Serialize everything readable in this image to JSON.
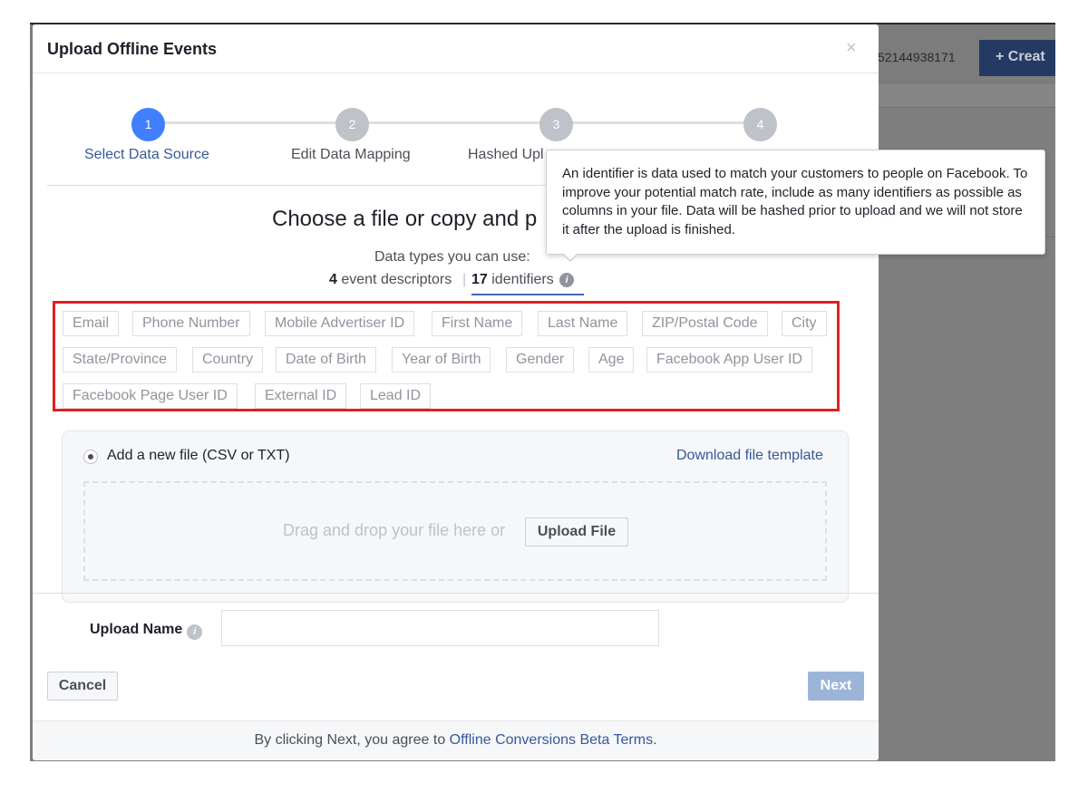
{
  "background": {
    "account_id": "52144938171",
    "create_label": "+ Creat"
  },
  "modal": {
    "title": "Upload Offline Events",
    "close_symbol": "×"
  },
  "steps": [
    {
      "number": "1",
      "label": "Select Data Source"
    },
    {
      "number": "2",
      "label": "Edit Data Mapping"
    },
    {
      "number": "3",
      "label": "Hashed Upl"
    },
    {
      "number": "4",
      "label": ""
    }
  ],
  "main": {
    "heading": "Choose a file or copy and p",
    "data_types_label": "Data types you can use:",
    "tabs": {
      "events_count": "4",
      "events_text": "event descriptors",
      "separator": "|",
      "identifiers_count": "17",
      "identifiers_text": "identifiers"
    },
    "identifiers": [
      "Email",
      "Phone Number",
      "Mobile Advertiser ID",
      "First Name",
      "Last Name",
      "ZIP/Postal Code",
      "City",
      "State/Province",
      "Country",
      "Date of Birth",
      "Year of Birth",
      "Gender",
      "Age",
      "Facebook App User ID",
      "Facebook Page User ID",
      "External ID",
      "Lead ID"
    ]
  },
  "file_panel": {
    "radio_label": "Add a new file (CSV or TXT)",
    "download_link": "Download file template",
    "drop_text": "Drag and drop your file here or",
    "upload_button": "Upload File"
  },
  "form": {
    "upload_name_label": "Upload Name",
    "upload_name_value": "",
    "cancel_label": "Cancel",
    "next_label": "Next"
  },
  "footer": {
    "prefix": "By clicking Next, you agree to ",
    "terms_link": "Offline Conversions Beta Terms",
    "suffix": "."
  },
  "tooltip": {
    "text": "An identifier is data used to match your customers to people on Facebook. To improve your potential match rate, include as many identifiers as possible as columns in your file. Data will be hashed prior to upload and we will not store it after the upload is finished."
  },
  "colors": {
    "accent": "#4080ff",
    "link": "#365899",
    "highlight_border": "#e02020",
    "next_disabled": "#9cb4d8"
  }
}
